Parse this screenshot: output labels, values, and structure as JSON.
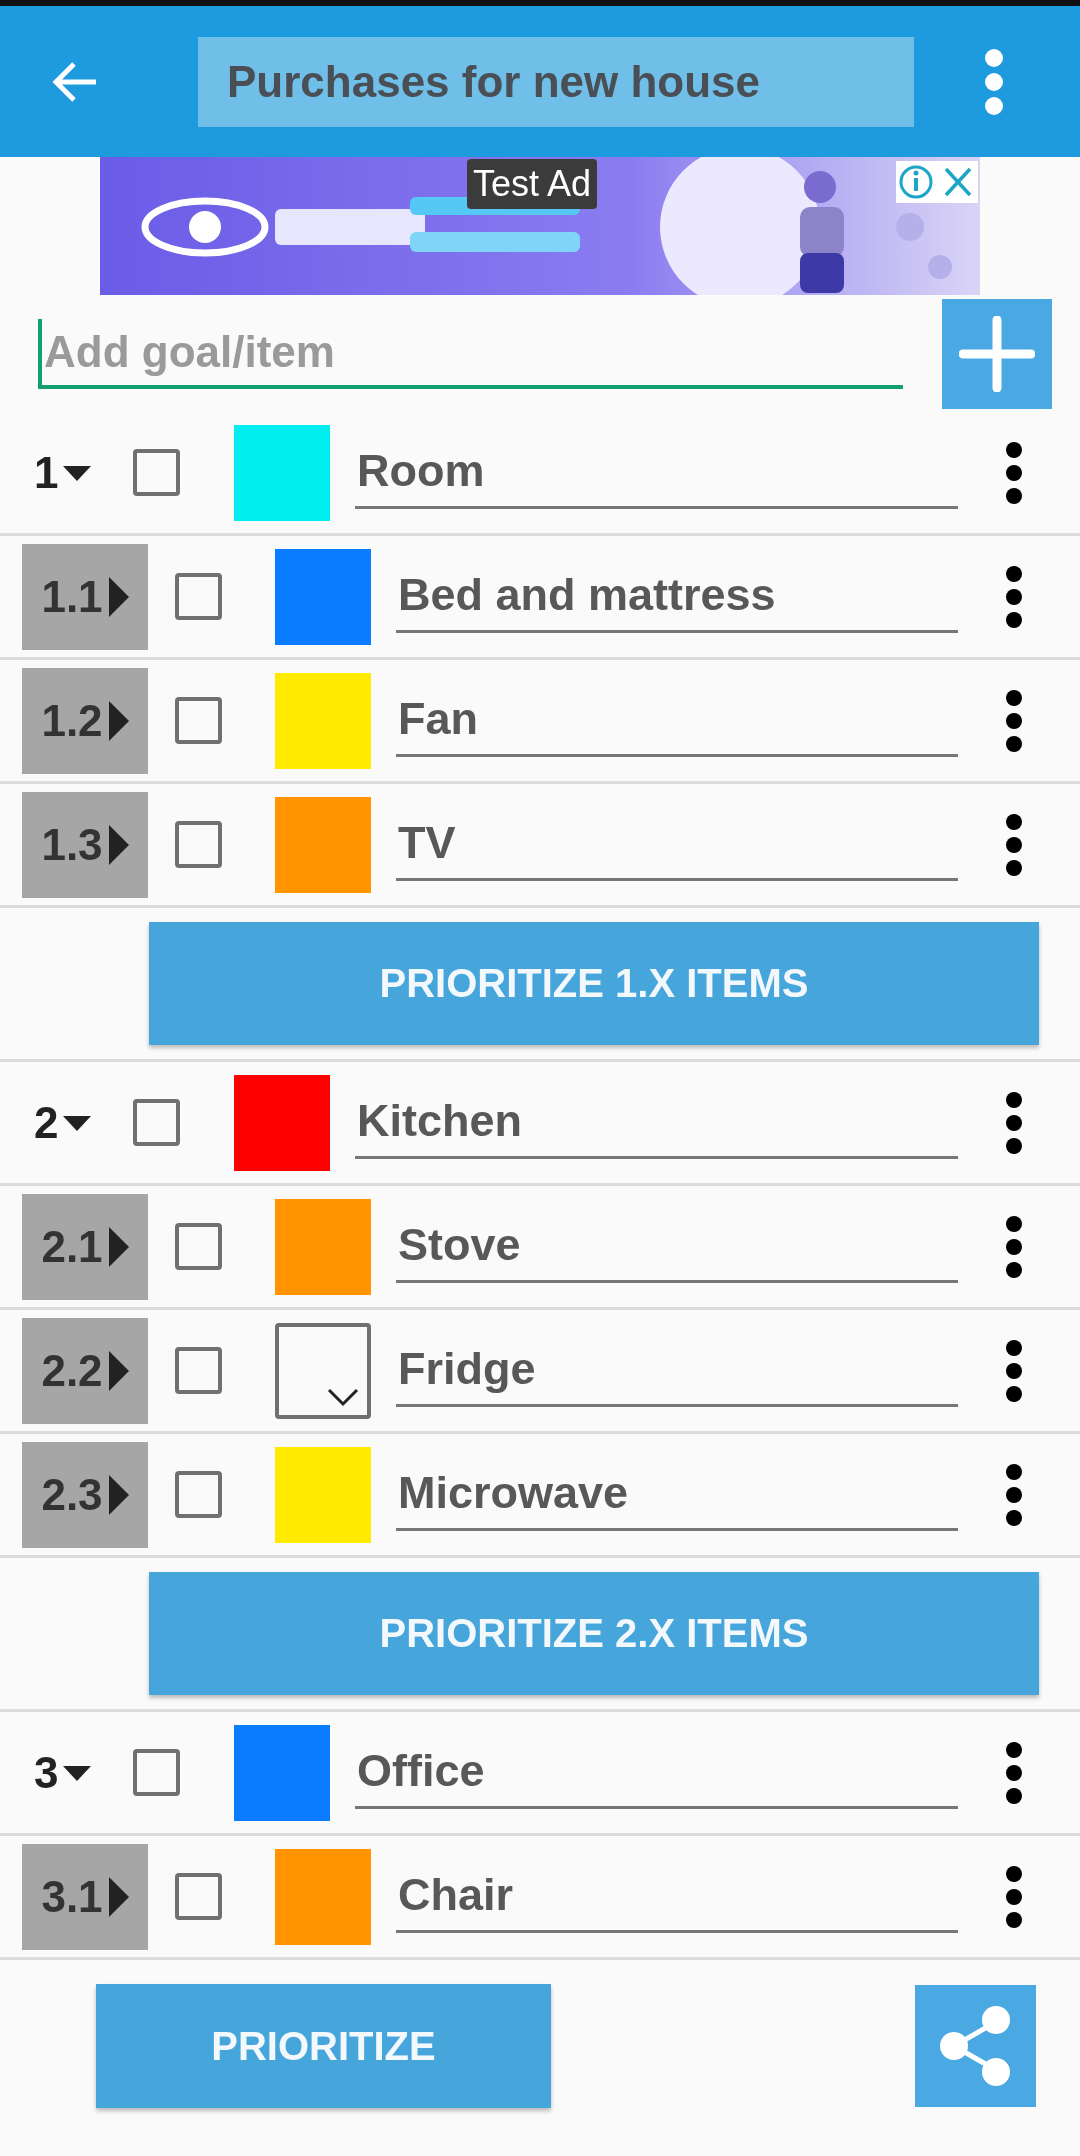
{
  "app_bar": {
    "title": "Purchases for new house"
  },
  "ad": {
    "label": "Test Ad"
  },
  "add_field": {
    "placeholder": "Add goal/item"
  },
  "groups": [
    {
      "number": "1",
      "expanded": true,
      "checked": false,
      "color": "#00eef0",
      "name": "Room",
      "prioritize_button": "PRIORITIZE 1.X ITEMS",
      "children": [
        {
          "number": "1.1",
          "expanded": false,
          "checked": false,
          "color": "#0a7cff",
          "name": "Bed and mattress"
        },
        {
          "number": "1.2",
          "expanded": false,
          "checked": false,
          "color": "#ffea00",
          "name": "Fan"
        },
        {
          "number": "1.3",
          "expanded": false,
          "checked": false,
          "color": "#ff9400",
          "name": "TV"
        }
      ]
    },
    {
      "number": "2",
      "expanded": true,
      "checked": false,
      "color": "#ff0000",
      "name": "Kitchen",
      "prioritize_button": "PRIORITIZE 2.X ITEMS",
      "children": [
        {
          "number": "2.1",
          "expanded": false,
          "checked": false,
          "color": "#ff9400",
          "name": "Stove"
        },
        {
          "number": "2.2",
          "expanded": false,
          "checked": false,
          "name": "Fridge"
        },
        {
          "number": "2.3",
          "expanded": false,
          "checked": false,
          "color": "#ffea00",
          "name": "Microwave"
        }
      ]
    },
    {
      "number": "3",
      "expanded": true,
      "checked": false,
      "color": "#0a7cff",
      "name": "Office",
      "children": [
        {
          "number": "3.1",
          "expanded": false,
          "checked": false,
          "color": "#ff9400",
          "name": "Chair"
        }
      ]
    }
  ],
  "bottom_bar": {
    "prioritize_button": "PRIORITIZE"
  }
}
